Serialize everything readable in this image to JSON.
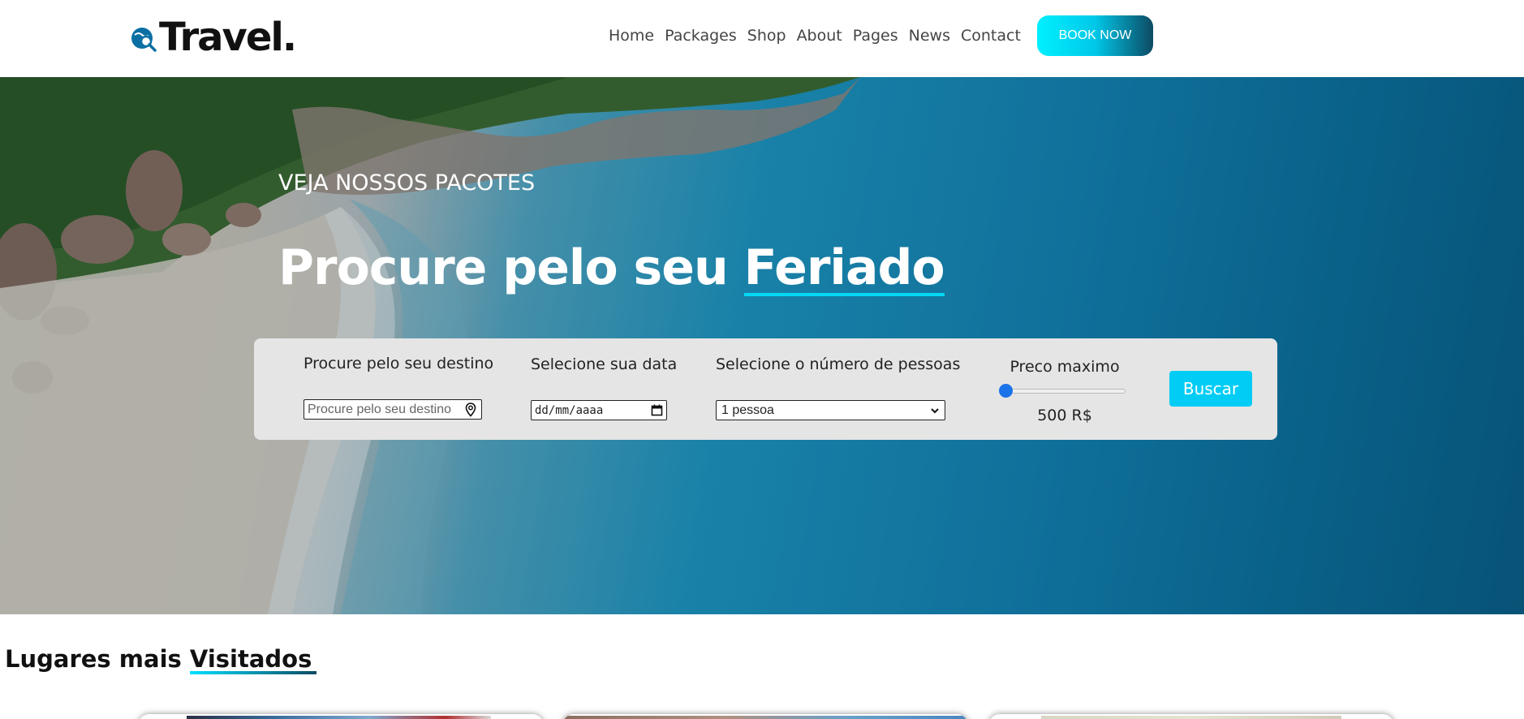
{
  "brand": {
    "name": "Travel."
  },
  "nav": {
    "items": [
      "Home",
      "Packages",
      "Shop",
      "About",
      "Pages",
      "News",
      "Contact"
    ],
    "cta": "BOOK NOW"
  },
  "hero": {
    "subtitle": "VEJA NOSSOS PACOTES",
    "headline_prefix": "Procure pelo seu",
    "headline_highlight": "Feriado"
  },
  "search": {
    "destination_label": "Procure pelo seu destino",
    "destination_placeholder": "Procure pelo seu destino",
    "date_label": "Selecione sua data",
    "date_value": "dd/mm/aaaa",
    "people_label": "Selecione o número de pessoas",
    "people_value": "1 pessoa",
    "price_label": "Preco maximo",
    "price_value": "500 R$",
    "price_slider_fraction": 0.0,
    "submit": "Buscar"
  },
  "section": {
    "title_prefix": "Lugares mais",
    "title_highlight": "Visitados"
  },
  "colors": {
    "accent": "#00ccf5",
    "cta_gradient_start": "#00f0ff",
    "cta_gradient_end": "#0d4a63",
    "slider_thumb": "#1a73e8",
    "search_panel_bg": "#e5e5e5"
  }
}
